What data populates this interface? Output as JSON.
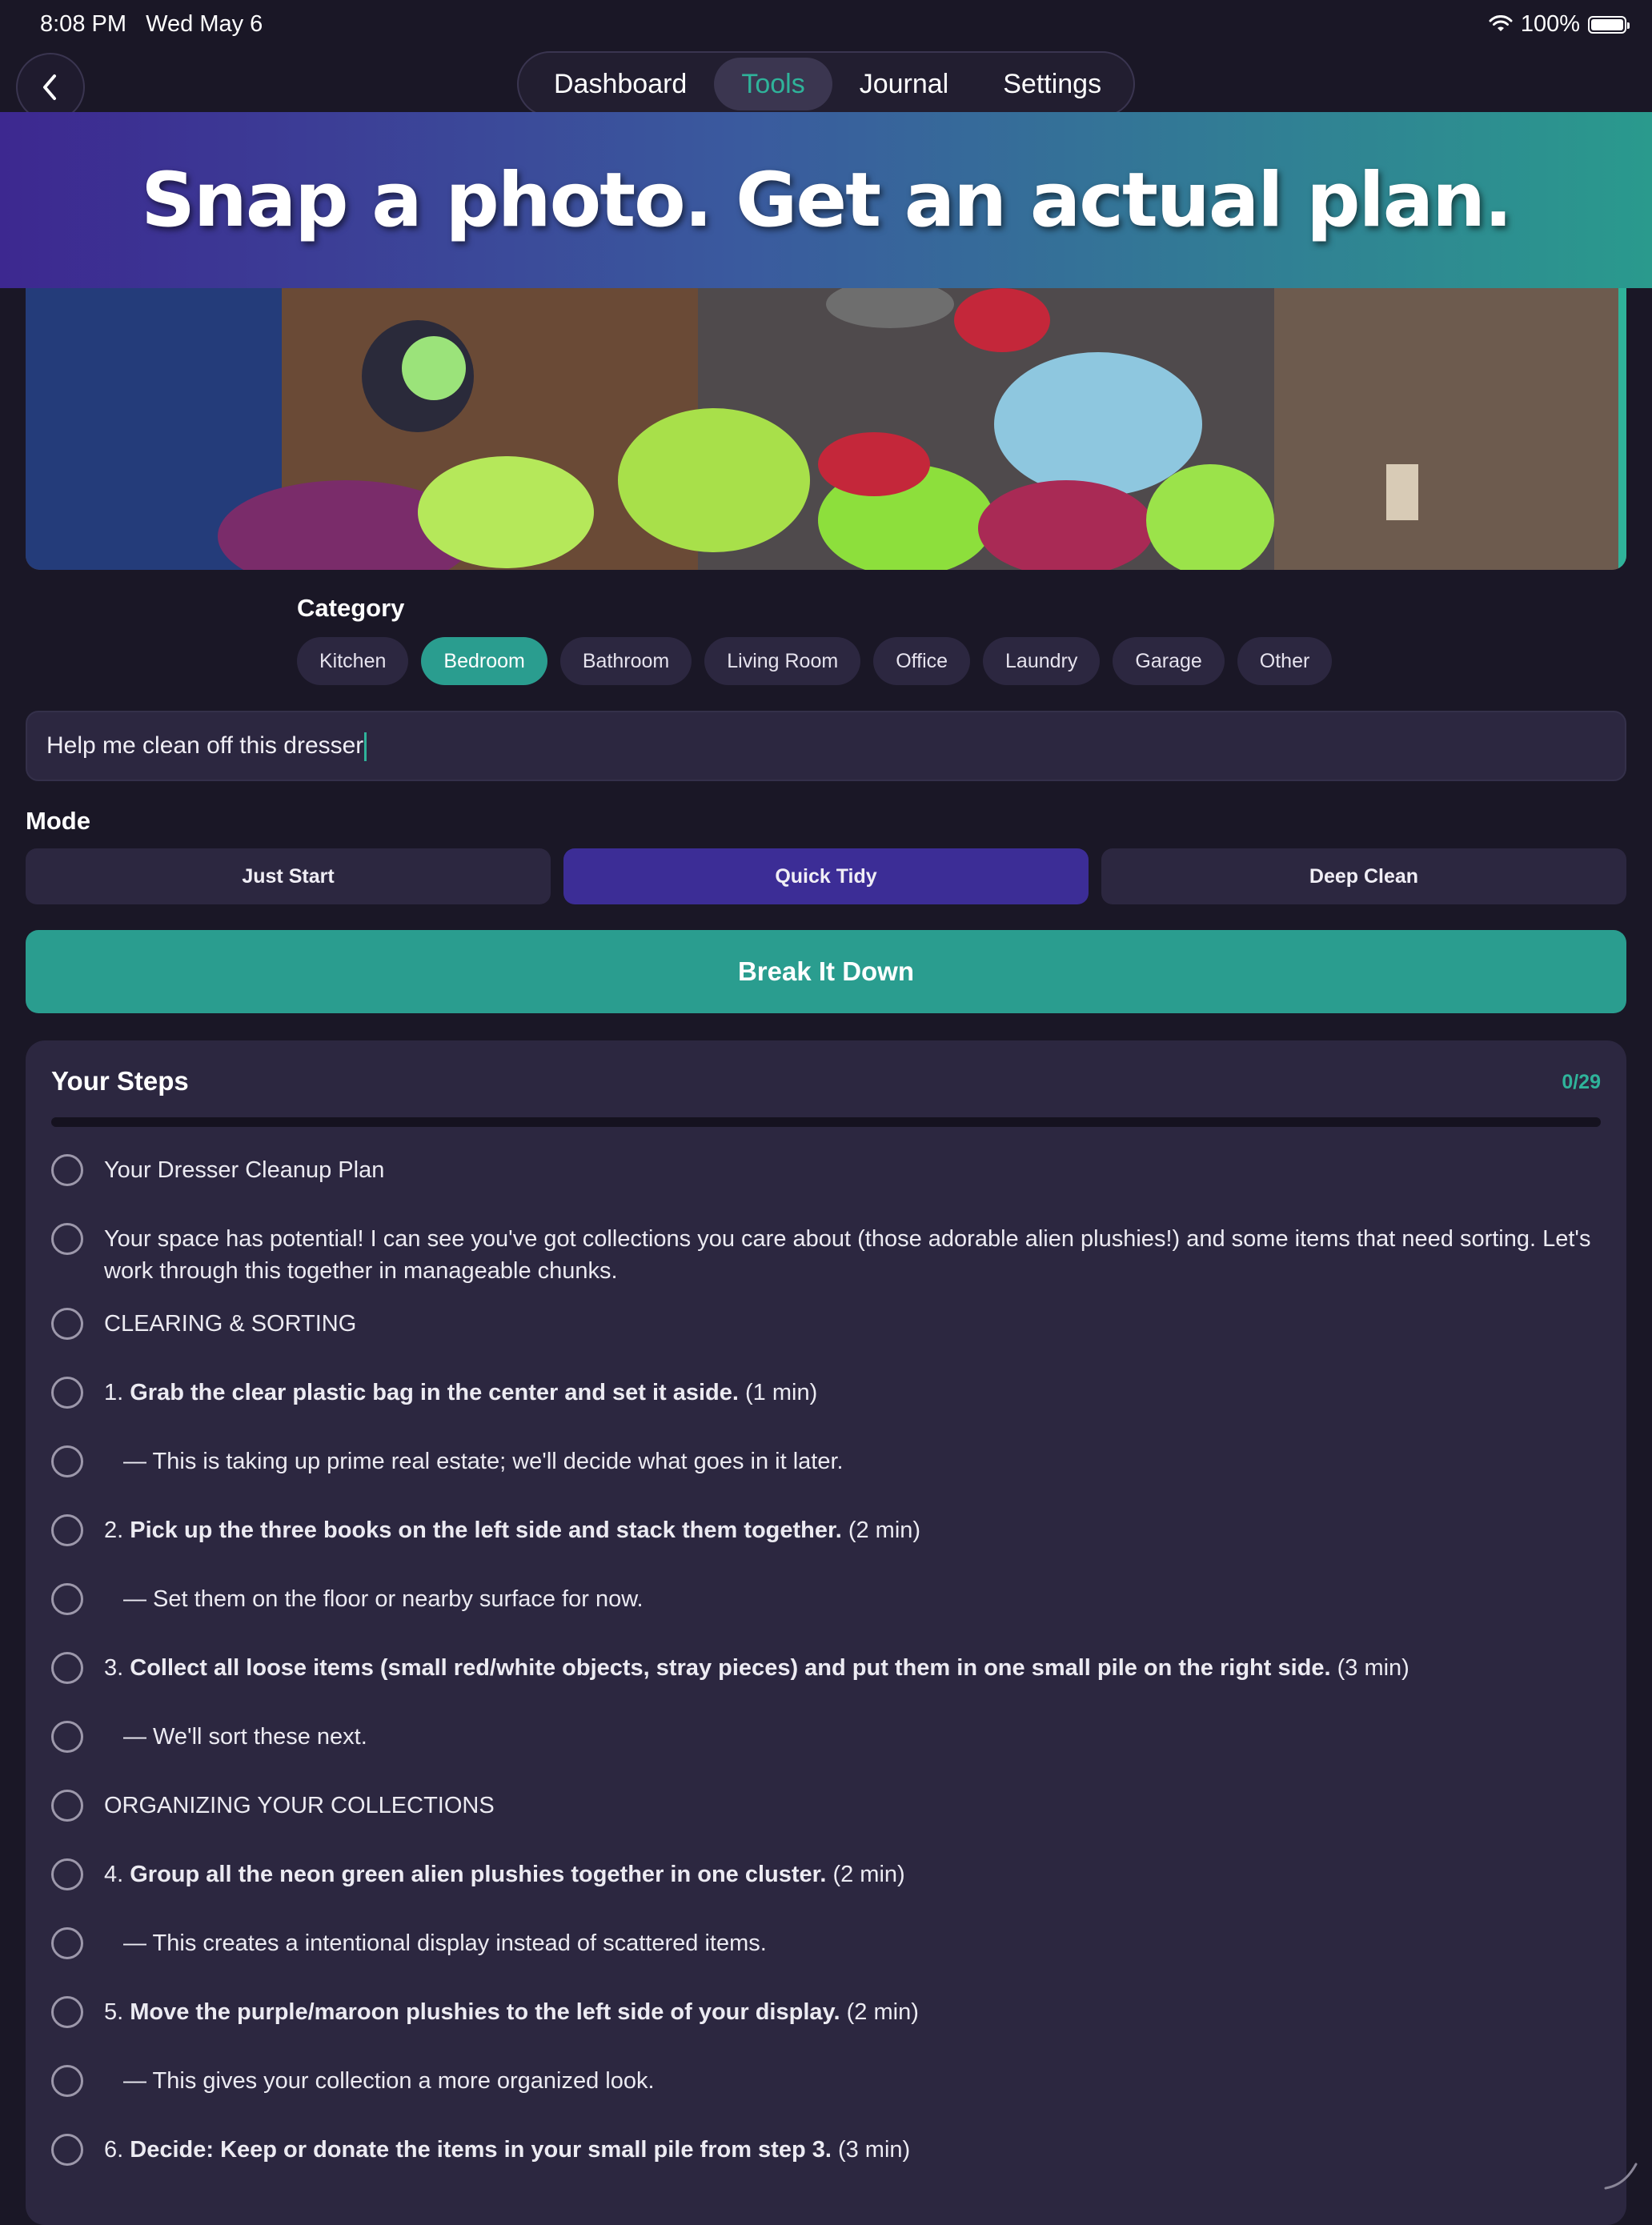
{
  "status_bar": {
    "time": "8:08 PM",
    "date": "Wed May 6",
    "battery": "100%"
  },
  "nav": {
    "tabs": [
      "Dashboard",
      "Tools",
      "Journal",
      "Settings"
    ],
    "active_tab": "Tools"
  },
  "banner": {
    "headline": "Snap a photo. Get an actual plan."
  },
  "category": {
    "label": "Category",
    "options": [
      "Kitchen",
      "Bedroom",
      "Bathroom",
      "Living Room",
      "Office",
      "Laundry",
      "Garage",
      "Other"
    ],
    "selected": "Bedroom"
  },
  "prompt": {
    "value": "Help me clean off this dresser"
  },
  "mode": {
    "label": "Mode",
    "options": [
      "Just Start",
      "Quick Tidy",
      "Deep Clean"
    ],
    "selected": "Quick Tidy"
  },
  "cta": {
    "label": "Break It Down"
  },
  "steps": {
    "title": "Your Steps",
    "count": "0/29",
    "progress_fraction": 0,
    "items": [
      {
        "number": "",
        "bold": "",
        "text": "Your Dresser Cleanup Plan",
        "duration": ""
      },
      {
        "number": "",
        "bold": "",
        "text": "Your space has potential! I can see you've got collections you care about (those adorable alien plushies!) and some items that need sorting. Let's work through this together in manageable chunks.",
        "duration": ""
      },
      {
        "number": "",
        "bold": "",
        "text": "CLEARING & SORTING",
        "duration": ""
      },
      {
        "number": "1. ",
        "bold": "Grab the clear plastic bag in the center and set it aside.",
        "text": "",
        "duration": " (1 min)"
      },
      {
        "number": "",
        "bold": "",
        "text": "— This is taking up prime real estate; we'll decide what goes in it later.",
        "duration": ""
      },
      {
        "number": "2. ",
        "bold": "Pick up the three books on the left side and stack them together.",
        "text": "",
        "duration": " (2 min)"
      },
      {
        "number": "",
        "bold": "",
        "text": "— Set them on the floor or nearby surface for now.",
        "duration": ""
      },
      {
        "number": "3. ",
        "bold": "Collect all loose items (small red/white objects, stray pieces) and put them in one small pile on the right side.",
        "text": "",
        "duration": " (3 min)"
      },
      {
        "number": "",
        "bold": "",
        "text": "— We'll sort these next.",
        "duration": ""
      },
      {
        "number": "",
        "bold": "",
        "text": "ORGANIZING YOUR COLLECTIONS",
        "duration": ""
      },
      {
        "number": "4. ",
        "bold": "Group all the neon green alien plushies together in one cluster.",
        "text": "",
        "duration": " (2 min)"
      },
      {
        "number": "",
        "bold": "",
        "text": "— This creates a intentional display instead of scattered items.",
        "duration": ""
      },
      {
        "number": "5. ",
        "bold": "Move the purple/maroon plushies to the left side of your display.",
        "text": "",
        "duration": " (2 min)"
      },
      {
        "number": "",
        "bold": "",
        "text": "— This gives your collection a more organized look.",
        "duration": ""
      },
      {
        "number": "6. ",
        "bold": "Decide: Keep or donate the items in your small pile from step 3.",
        "text": "",
        "duration": " (3 min)"
      }
    ]
  },
  "colors": {
    "background": "#1a1726",
    "card": "#2c2740",
    "accent_teal": "#2a9d8f",
    "accent_purple": "#3c2d96"
  }
}
